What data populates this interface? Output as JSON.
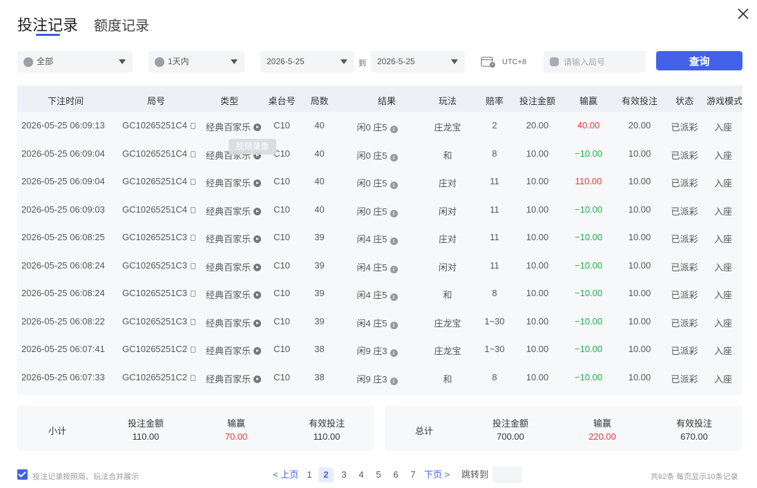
{
  "tabs": {
    "active": "投注记录",
    "inactive": "额度记录"
  },
  "filters": {
    "scope": "全部",
    "range": "1天内",
    "date_from": "2026-5-25",
    "to_label": "到",
    "date_to": "2026-5-25",
    "timezone": "UTC+8",
    "round_placeholder": "请输入局号",
    "query_label": "查询"
  },
  "columns": [
    "下注时间",
    "局号",
    "类型",
    "桌台号",
    "局数",
    "结果",
    "玩法",
    "赔率",
    "投注金额",
    "输赢",
    "有效投注",
    "状态",
    "游戏模式"
  ],
  "rows": [
    {
      "time": "2026-05-25 06:09:13",
      "round": "GC10265251C4",
      "type": "经典百家乐",
      "table": "C10",
      "count": "40",
      "result": "闲0 庄5",
      "play": "庄龙宝",
      "odds": "2",
      "bet": "20.00",
      "winloss": "40.00",
      "valid": "20.00",
      "status": "已派彩",
      "mode": "入座"
    },
    {
      "time": "2026-05-25 06:09:04",
      "round": "GC10265251C4",
      "type": "经典百家乐",
      "table": "C10",
      "count": "40",
      "result": "闲0 庄5",
      "play": "和",
      "odds": "8",
      "bet": "10.00",
      "winloss": "−10.00",
      "valid": "10.00",
      "status": "已派彩",
      "mode": "入座"
    },
    {
      "time": "2026-05-25 06:09:04",
      "round": "GC10265251C4",
      "type": "经典百家乐",
      "table": "C10",
      "count": "40",
      "result": "闲0 庄5",
      "play": "庄对",
      "odds": "11",
      "bet": "10.00",
      "winloss": "110.00",
      "valid": "10.00",
      "status": "已派彩",
      "mode": "入座"
    },
    {
      "time": "2026-05-25 06:09:03",
      "round": "GC10265251C4",
      "type": "经典百家乐",
      "table": "C10",
      "count": "40",
      "result": "闲0 庄5",
      "play": "闲对",
      "odds": "11",
      "bet": "10.00",
      "winloss": "−10.00",
      "valid": "10.00",
      "status": "已派彩",
      "mode": "入座"
    },
    {
      "time": "2026-05-25 06:08:25",
      "round": "GC10265251C3",
      "type": "经典百家乐",
      "table": "C10",
      "count": "39",
      "result": "闲4 庄5",
      "play": "庄对",
      "odds": "11",
      "bet": "10.00",
      "winloss": "−10.00",
      "valid": "10.00",
      "status": "已派彩",
      "mode": "入座"
    },
    {
      "time": "2026-05-25 06:08:24",
      "round": "GC10265251C3",
      "type": "经典百家乐",
      "table": "C10",
      "count": "39",
      "result": "闲4 庄5",
      "play": "闲对",
      "odds": "11",
      "bet": "10.00",
      "winloss": "−10.00",
      "valid": "10.00",
      "status": "已派彩",
      "mode": "入座"
    },
    {
      "time": "2026-05-25 06:08:24",
      "round": "GC10265251C3",
      "type": "经典百家乐",
      "table": "C10",
      "count": "39",
      "result": "闲4 庄5",
      "play": "和",
      "odds": "8",
      "bet": "10.00",
      "winloss": "−10.00",
      "valid": "10.00",
      "status": "已派彩",
      "mode": "入座"
    },
    {
      "time": "2026-05-25 06:08:22",
      "round": "GC10265251C3",
      "type": "经典百家乐",
      "table": "C10",
      "count": "39",
      "result": "闲4 庄5",
      "play": "庄龙宝",
      "odds": "1~30",
      "bet": "10.00",
      "winloss": "−10.00",
      "valid": "10.00",
      "status": "已派彩",
      "mode": "入座"
    },
    {
      "time": "2026-05-25 06:07:41",
      "round": "GC10265251C2",
      "type": "经典百家乐",
      "table": "C10",
      "count": "38",
      "result": "闲9 庄3",
      "play": "庄龙宝",
      "odds": "1~30",
      "bet": "10.00",
      "winloss": "−10.00",
      "valid": "10.00",
      "status": "已派彩",
      "mode": "入座"
    },
    {
      "time": "2026-05-25 06:07:33",
      "round": "GC10265251C2",
      "type": "经典百家乐",
      "table": "C10",
      "count": "38",
      "result": "闲9 庄3",
      "play": "和",
      "odds": "8",
      "bet": "10.00",
      "winloss": "−10.00",
      "valid": "10.00",
      "status": "已派彩",
      "mode": "入座"
    }
  ],
  "tooltip": "视频录像",
  "subtotal": {
    "label": "小计",
    "bet_label": "投注金额",
    "bet": "110.00",
    "winloss_label": "输赢",
    "winloss": "70.00",
    "valid_label": "有效投注",
    "valid": "110.00"
  },
  "total": {
    "label": "总计",
    "bet_label": "投注金额",
    "bet": "700.00",
    "winloss_label": "输赢",
    "winloss": "220.00",
    "valid_label": "有效投注",
    "valid": "670.00"
  },
  "footer": {
    "merge_label": "投注记录按照局、玩法合并展示",
    "prev": "< 上页",
    "pages": [
      "1",
      "2",
      "3",
      "4",
      "5",
      "6",
      "7"
    ],
    "current_page": "2",
    "next": "下页 >",
    "jump_label": "跳转到",
    "summary": "共62条  每页显示10条记录"
  },
  "colors": {
    "accent": "#4361e8",
    "win": "#e53935",
    "lose": "#18b24a"
  }
}
